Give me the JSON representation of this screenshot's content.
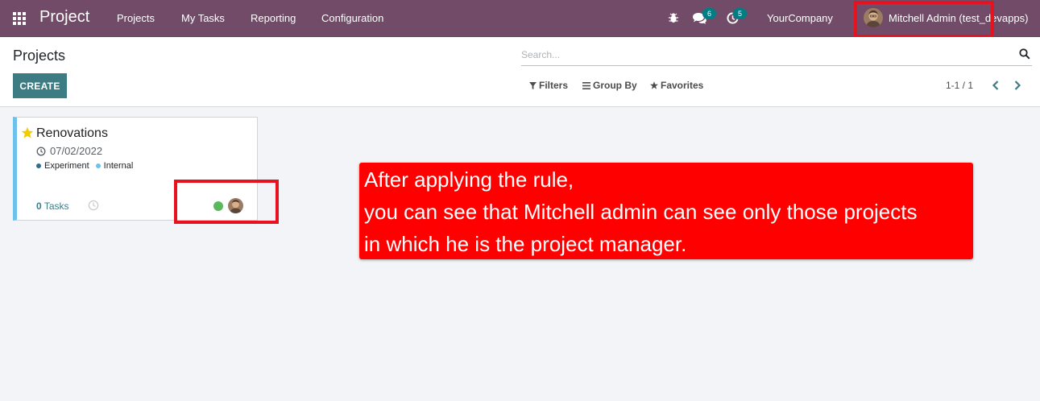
{
  "navbar": {
    "app_title": "Project",
    "menu": [
      "Projects",
      "My Tasks",
      "Reporting",
      "Configuration"
    ],
    "messages_count": "6",
    "activities_count": "5",
    "company": "YourCompany",
    "user": "Mitchell Admin (test_devapps)",
    "color": "#714b67"
  },
  "control_panel": {
    "breadcrumb": "Projects",
    "create_label": "CREATE",
    "search_placeholder": "Search...",
    "filters_label": "Filters",
    "groupby_label": "Group By",
    "favorites_label": "Favorites",
    "pager_value": "1-1 / 1",
    "accent": "#3e7c84"
  },
  "project_card": {
    "name": "Renovations",
    "date": "07/02/2022",
    "tags": [
      {
        "label": "Experiment",
        "color": "#2e6d8e"
      },
      {
        "label": "Internal",
        "color": "#6cc1ed"
      }
    ],
    "tasks_count": "0",
    "tasks_label": "Tasks",
    "status_color": "#5cb85c"
  },
  "annotation": {
    "lines": [
      "After applying the rule,",
      "you can see that Mitchell admin can see only those projects",
      "in which he is the project manager."
    ],
    "color": "#ff0000"
  }
}
